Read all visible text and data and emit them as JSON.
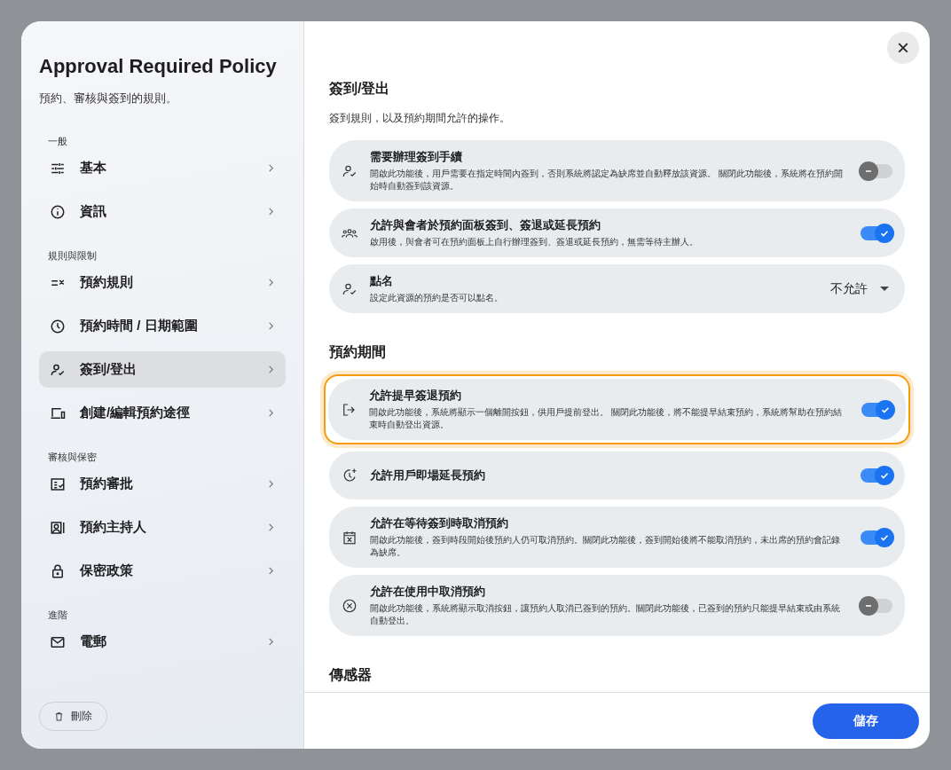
{
  "sidebar": {
    "title": "Approval Required Policy",
    "subtitle": "預約、審核與簽到的規則。",
    "groups": [
      {
        "label": "一般",
        "items": [
          {
            "label": "基本",
            "selected": false
          },
          {
            "label": "資訊",
            "selected": false
          }
        ]
      },
      {
        "label": "規則與限制",
        "items": [
          {
            "label": "預約規則",
            "selected": false
          },
          {
            "label": "預約時間 / 日期範圍",
            "selected": false
          },
          {
            "label": "簽到/登出",
            "selected": true
          },
          {
            "label": "創建/編輯預約途徑",
            "selected": false
          }
        ]
      },
      {
        "label": "審核與保密",
        "items": [
          {
            "label": "預約審批",
            "selected": false
          },
          {
            "label": "預約主持人",
            "selected": false
          },
          {
            "label": "保密政策",
            "selected": false
          }
        ]
      },
      {
        "label": "進階",
        "items": [
          {
            "label": "電郵",
            "selected": false
          }
        ]
      }
    ],
    "delete_button": "刪除"
  },
  "close_button": "×",
  "sections": [
    {
      "title": "簽到/登出",
      "description": "簽到規則，以及預約期間允許的操作。",
      "settings": [
        {
          "kind": "toggle",
          "title": "需要辦理簽到手續",
          "description": "開啟此功能後，用戶需要在指定時間內簽到，否則系統將認定為缺席並自動釋放該資源。 關閉此功能後，系統將在預約開始時自動簽到該資源。",
          "on": false,
          "highlighted": false
        },
        {
          "kind": "toggle",
          "title": "允許與會者於預約面板簽到、簽退或延長預約",
          "description": "啟用後，與會者可在預約面板上自行辦理簽到、簽退或延長預約，無需等待主辦人。",
          "on": true,
          "highlighted": false
        },
        {
          "kind": "select",
          "title": "點名",
          "description": "設定此資源的預約是否可以點名。",
          "value": "不允許",
          "highlighted": false
        }
      ]
    },
    {
      "title": "預約期間",
      "settings": [
        {
          "kind": "toggle",
          "title": "允許提早簽退預約",
          "description": "開啟此功能後，系統將顯示一個離開按鈕，供用戶提前登出。 關閉此功能後，將不能提早結束預約，系統將幫助在預約結束時自動登出資源。",
          "on": true,
          "highlighted": true
        },
        {
          "kind": "toggle",
          "title": "允許用戶即場延長預約",
          "on": true,
          "highlighted": false
        },
        {
          "kind": "toggle",
          "title": "允許在等待簽到時取消預約",
          "description": "開啟此功能後，簽到時段開始後預約人仍可取消預約。關閉此功能後，簽到開始後將不能取消預約，未出席的預約會記錄為缺席。",
          "on": true,
          "highlighted": false
        },
        {
          "kind": "toggle",
          "title": "允許在使用中取消預約",
          "description": "開啟此功能後，系統將顯示取消按鈕，讓預約人取消已簽到的預約。關閉此功能後，已簽到的預約只能提早結束或由系統自動登出。",
          "on": false,
          "highlighted": false
        }
      ]
    },
    {
      "title": "傳感器"
    }
  ],
  "save_button": "儲存"
}
